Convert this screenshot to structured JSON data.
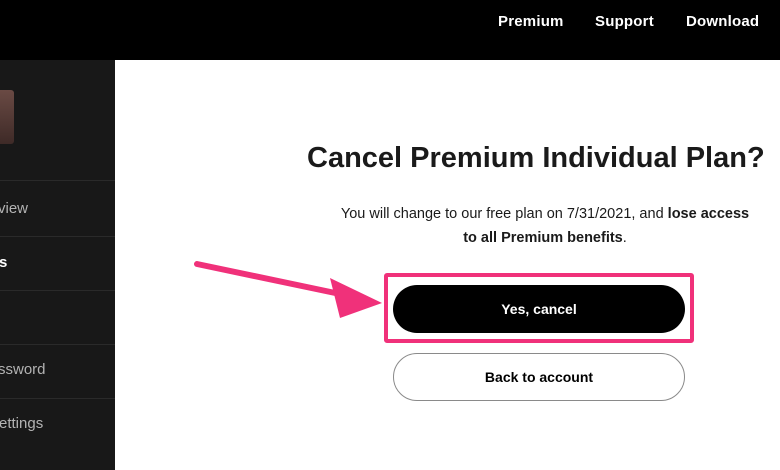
{
  "topbar": {
    "nav": [
      {
        "label": "Premium"
      },
      {
        "label": "Support"
      },
      {
        "label": "Download"
      }
    ]
  },
  "sidebar": {
    "items": [
      {
        "label": "view",
        "active": false
      },
      {
        "label": "s",
        "active": true
      },
      {
        "label": "ssword",
        "active": false
      },
      {
        "label": "ettings",
        "active": false
      }
    ]
  },
  "main": {
    "title": "Cancel Premium Individual Plan?",
    "description": {
      "line1_prefix": "You will change to our free plan on 7/31/2021, and ",
      "line1_bold": "lose access",
      "line2_bold": "to all Premium benefits",
      "line2_suffix": "."
    },
    "confirm_button": "Yes, cancel",
    "back_button": "Back to account"
  },
  "annotation": {
    "highlight_color": "#f0317a",
    "arrow_color": "#f0317a"
  },
  "colors": {
    "topbar_bg": "#000000",
    "sidebar_bg": "#181818",
    "main_bg": "#ffffff"
  }
}
